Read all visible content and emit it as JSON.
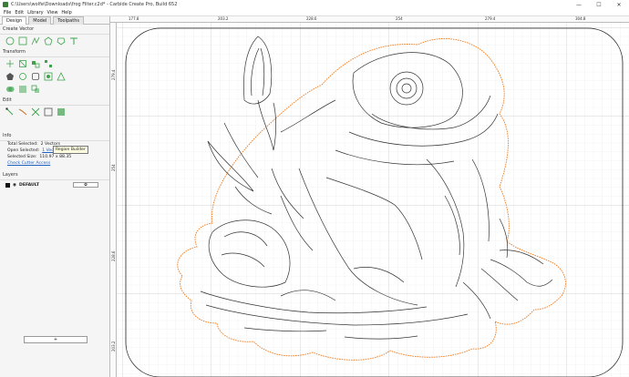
{
  "window": {
    "title": "C:\\Users\\wolfe\\Downloads\\frog Filter.c2d* - Carbide Create Pro, Build 652",
    "controls": [
      "—",
      "☐",
      "✕"
    ]
  },
  "menu": [
    "File",
    "Edit",
    "Library",
    "View",
    "Help"
  ],
  "sidebar": {
    "tabs": [
      "Design",
      "Model",
      "Toolpaths"
    ],
    "sections": {
      "create_vector": "Create Vector",
      "transform": "Transform",
      "edit": "Edit",
      "info": "Info",
      "layers": "Layers"
    },
    "tooltip": "Region Builder",
    "info": {
      "total_label": "Total Selected:",
      "total_value": "2 Vectors",
      "open_label": "Open Selected:",
      "open_value": "1 Vectors",
      "size_label": "Selected Size:",
      "size_value": "110.97 x 88.35",
      "check_link": "Check Cutter Access"
    },
    "layer": {
      "name": "DEFAULT",
      "gear": "✿"
    },
    "bottom_button": "+"
  },
  "rulers": {
    "top": [
      "177.8",
      "203.2",
      "228.6",
      "254",
      "279.4",
      "304.8"
    ],
    "left": [
      "279.4",
      "254",
      "228.6",
      "203.2"
    ]
  },
  "colors": {
    "accent_green": "#3fa34d",
    "toolpath_orange": "#f07a1a",
    "ruler_marker": "#e53935"
  }
}
